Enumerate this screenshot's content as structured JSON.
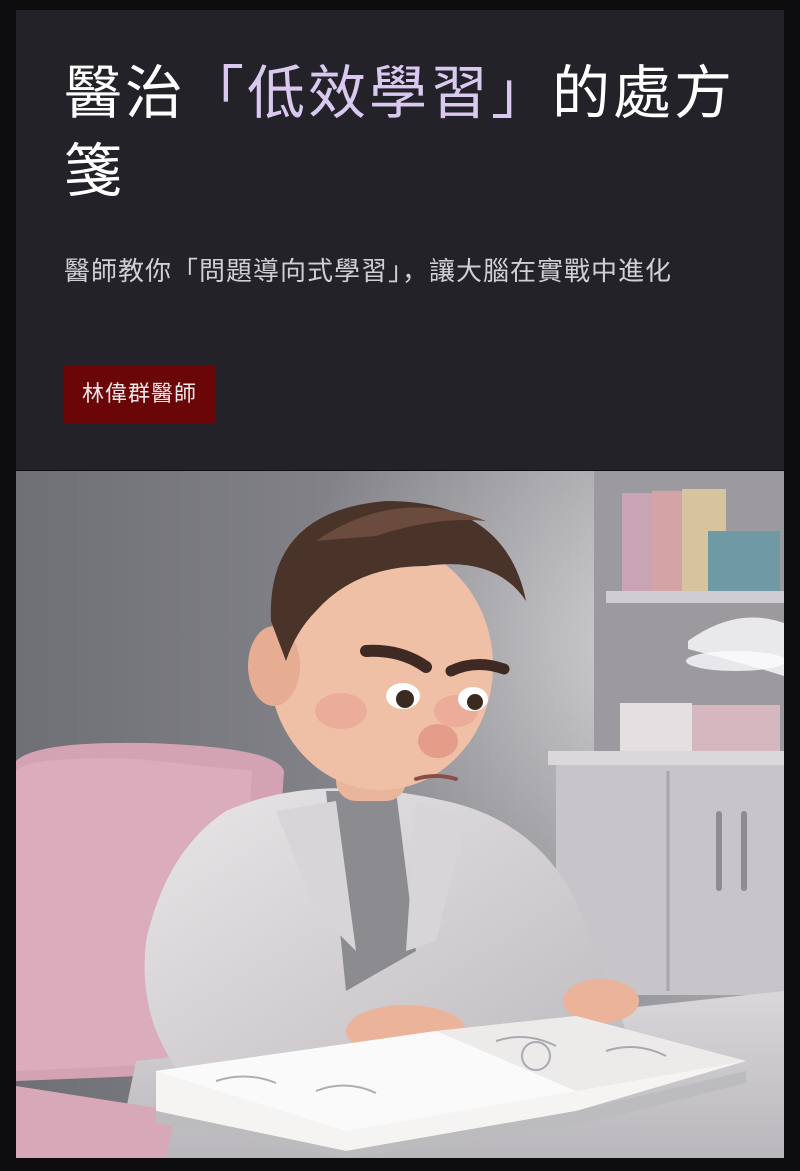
{
  "article": {
    "title_prefix": "醫治",
    "title_highlight": "「低效學習」",
    "title_suffix": "的處方箋",
    "subtitle": "醫師教你「問題導向式學習」，讓大腦在實戰中進化",
    "author": "林偉群醫師"
  },
  "colors": {
    "card_bg": "#232228",
    "title_highlight": "#d9c8f0",
    "author_badge_bg": "#6b0608"
  }
}
